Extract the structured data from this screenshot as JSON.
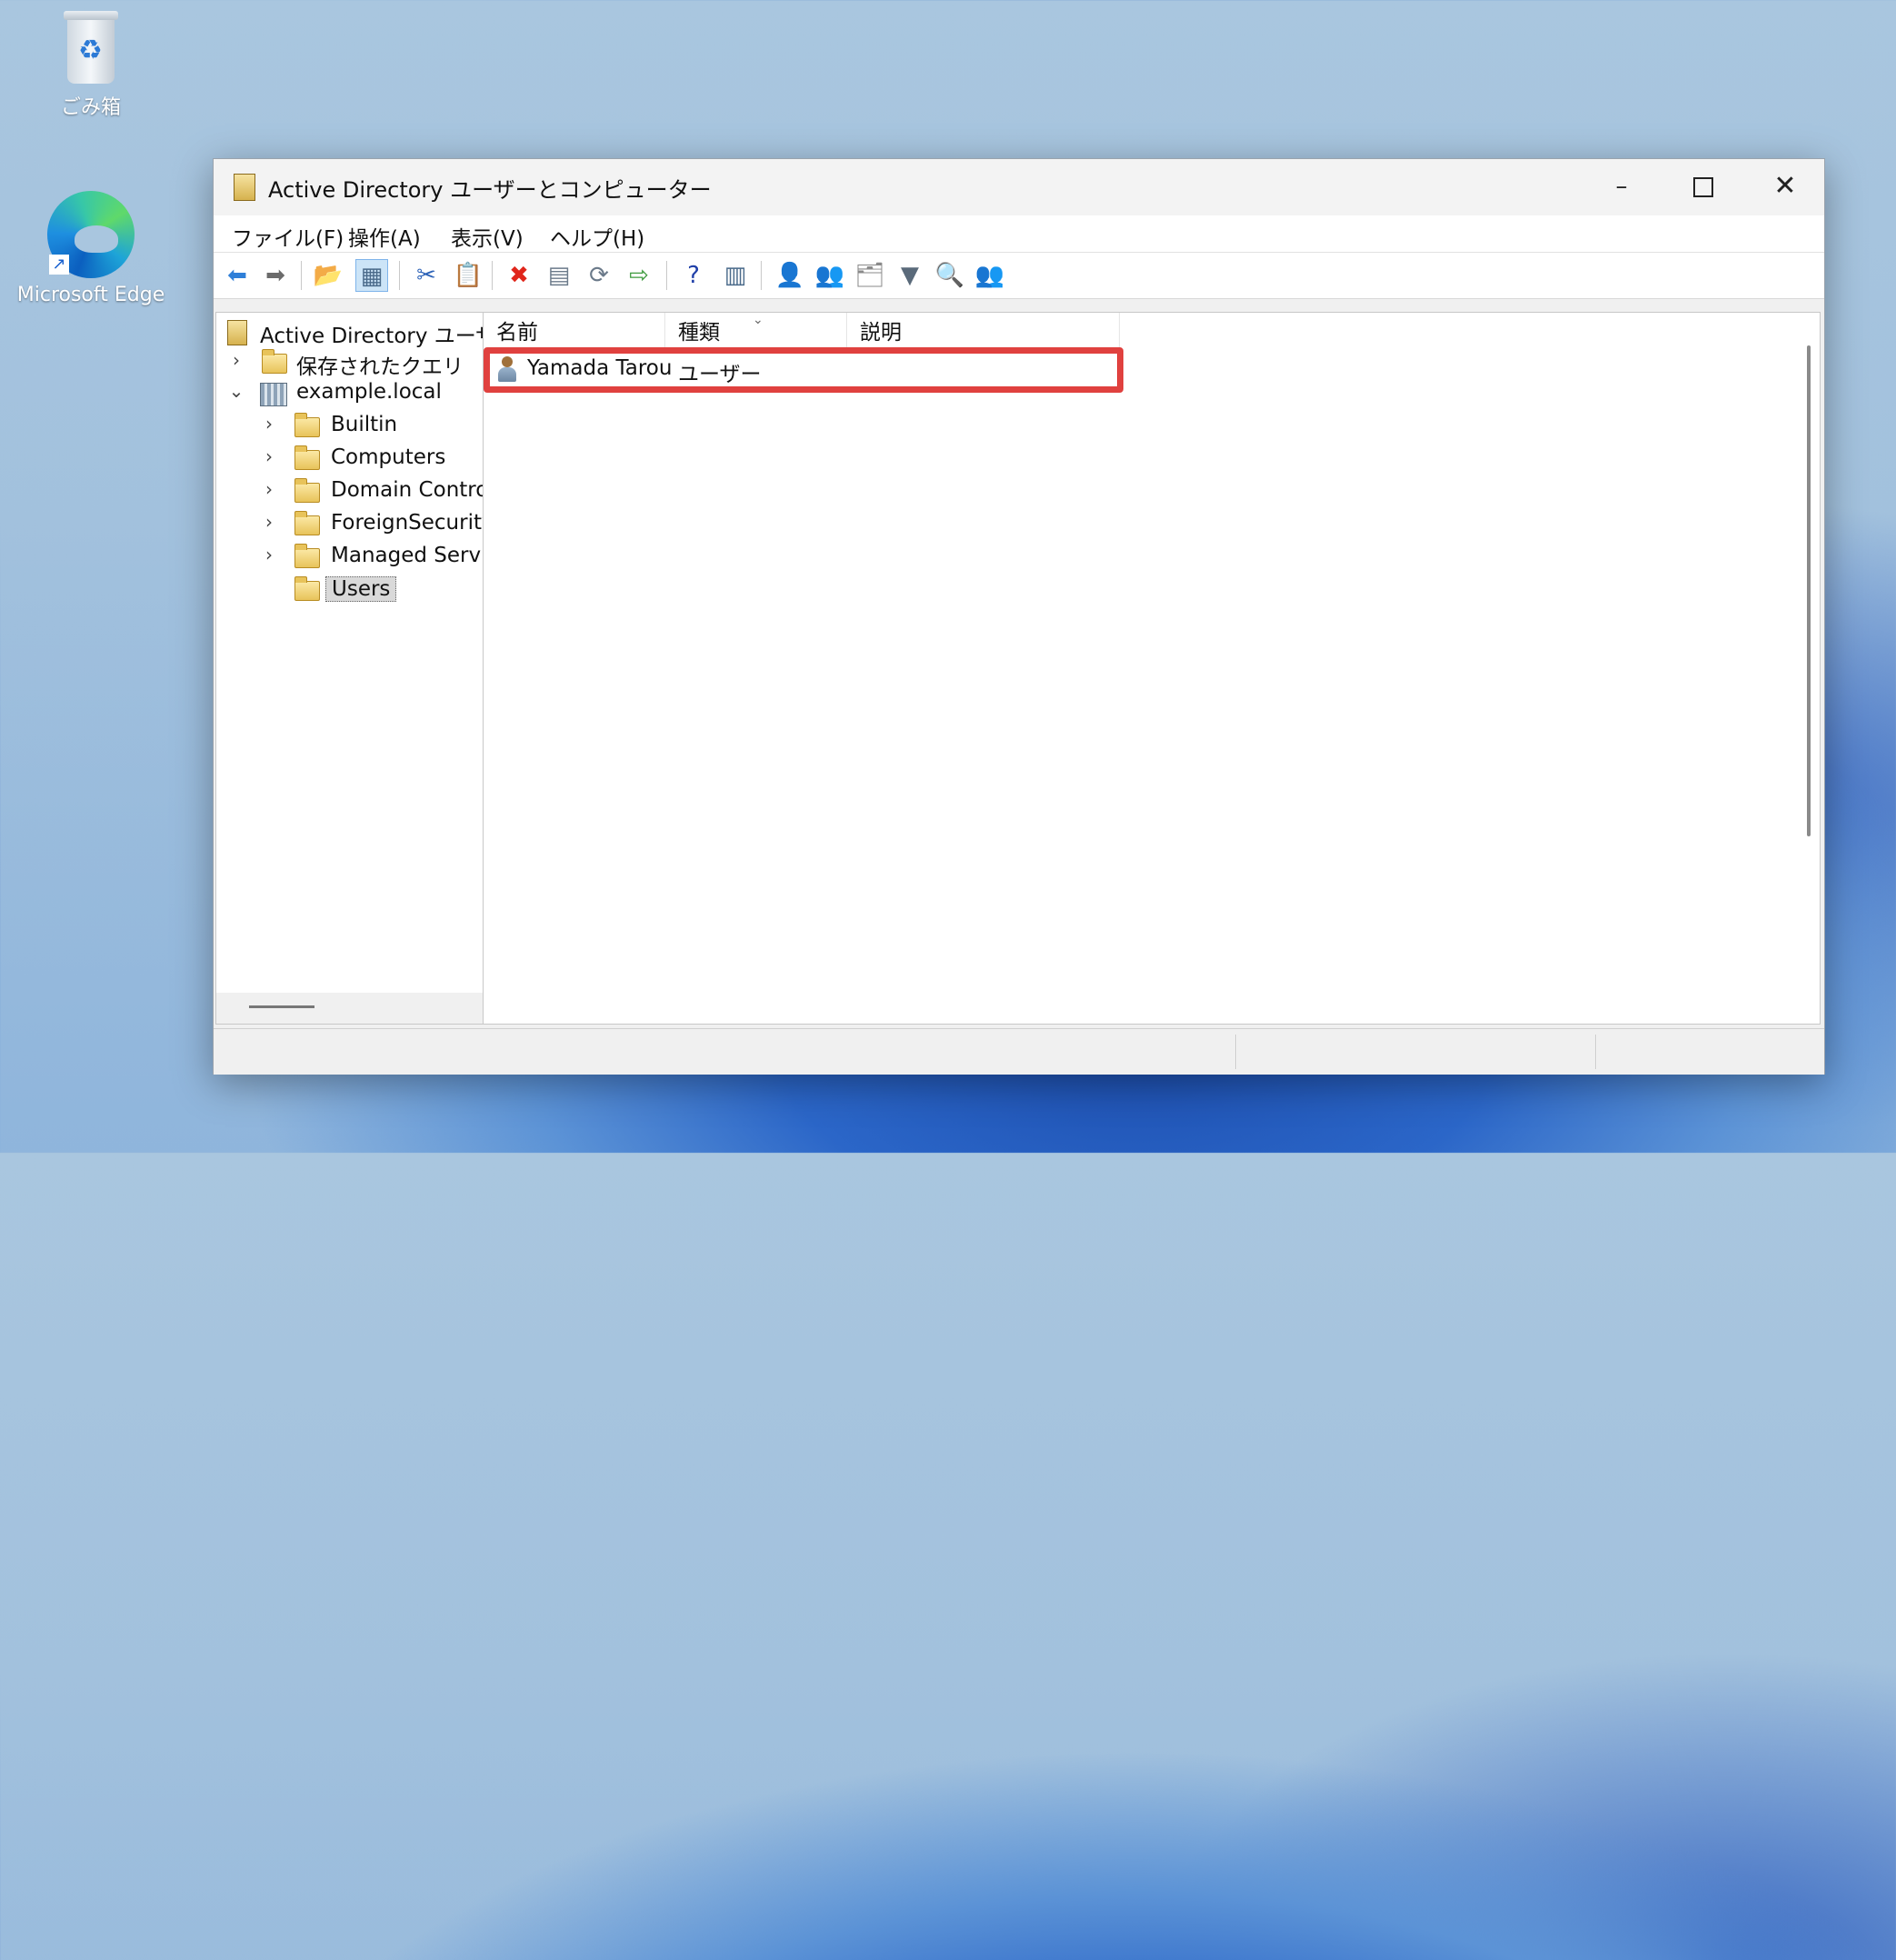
{
  "desktop": {
    "recycle_bin_label": "ごみ箱",
    "edge_label": "Microsoft Edge"
  },
  "window": {
    "title": "Active Directory ユーザーとコンピューター",
    "controls": {
      "minimize": "–",
      "close": "✕"
    }
  },
  "menu": {
    "items": [
      {
        "label": "ファイル(F)"
      },
      {
        "label": "操作(A)"
      },
      {
        "label": "表示(V)"
      },
      {
        "label": "ヘルプ(H)"
      }
    ]
  },
  "toolbar": {
    "icons": [
      {
        "name": "back-arrow-icon",
        "glyph": "⬅",
        "color": "#2f7fd8"
      },
      {
        "name": "forward-arrow-icon",
        "glyph": "➡",
        "color": "#6b6b6b"
      },
      {
        "name": "up-folder-icon",
        "glyph": "📂",
        "color": "#c9a03a"
      },
      {
        "name": "show-hide-console-tree-icon",
        "glyph": "▦",
        "color": "#4a6a8a"
      },
      {
        "name": "cut-icon",
        "glyph": "✂",
        "color": "#2f64b8"
      },
      {
        "name": "copy-icon",
        "glyph": "📋",
        "color": "#555555"
      },
      {
        "name": "delete-icon",
        "glyph": "✖",
        "color": "#e0261b"
      },
      {
        "name": "properties-icon",
        "glyph": "▤",
        "color": "#6b7a8a"
      },
      {
        "name": "refresh-icon",
        "glyph": "⟳",
        "color": "#6b7a8a"
      },
      {
        "name": "export-list-icon",
        "glyph": "⇨",
        "color": "#3d9a3d"
      },
      {
        "name": "help-icon",
        "glyph": "?",
        "color": "#1f3fa8"
      },
      {
        "name": "action-pane-icon",
        "glyph": "▥",
        "color": "#4a6a8a"
      },
      {
        "name": "new-user-icon",
        "glyph": "👤",
        "color": "#b07a3a"
      },
      {
        "name": "new-group-icon",
        "glyph": "👥",
        "color": "#b07a3a"
      },
      {
        "name": "new-ou-icon",
        "glyph": "🗂",
        "color": "#8a8a8a"
      },
      {
        "name": "filter-icon",
        "glyph": "▼",
        "color": "#5a6a7a"
      },
      {
        "name": "find-icon",
        "glyph": "🔍",
        "color": "#c9a03a"
      },
      {
        "name": "add-to-group-icon",
        "glyph": "👥",
        "color": "#3a8a5a"
      }
    ]
  },
  "tree": {
    "root": "Active Directory ユーザ",
    "saved_queries": "保存されたクエリ",
    "domain": "example.local",
    "containers": [
      {
        "label": "Builtin",
        "icon": "folder-icon"
      },
      {
        "label": "Computers",
        "icon": "folder-icon"
      },
      {
        "label": "Domain Contro",
        "icon": "ou-folder-icon"
      },
      {
        "label": "ForeignSecurity",
        "icon": "folder-icon"
      },
      {
        "label": "Managed Servi",
        "icon": "folder-icon"
      }
    ],
    "selected": "Users"
  },
  "list": {
    "columns": [
      "名前",
      "種類",
      "説明"
    ],
    "rows": [
      {
        "name": "Yamada Tarou",
        "type": "ユーザー",
        "description": ""
      }
    ]
  },
  "colors": {
    "highlight_border": "#e0413f",
    "selection_bg": "#d9d9d9"
  }
}
